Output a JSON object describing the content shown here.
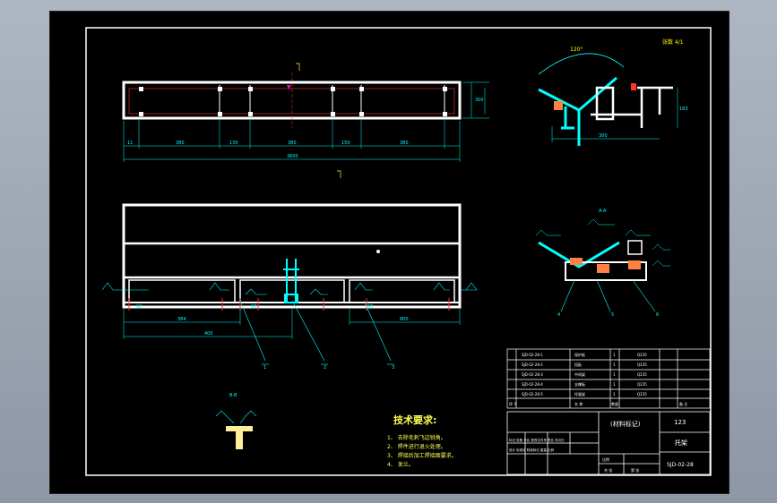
{
  "drawing": {
    "section_aa_label": "A-A",
    "section_bb_label": "B-B",
    "top_view": {
      "overall_length": "3600",
      "spans": [
        "11",
        "380",
        "130",
        "380",
        "150",
        "380"
      ],
      "height_dim": "300"
    },
    "callouts": [
      "1",
      "2",
      "3"
    ],
    "aa_callouts": [
      "4",
      "5",
      "6"
    ],
    "angle_label": "120°",
    "technical_requirements": {
      "title": "技术要求:",
      "items": [
        "1、 去除毛刺飞边锐角。",
        "2、 焊件进行退火处理。",
        "3、 焊接后加工焊接面要求。",
        "4、 发兰。"
      ]
    },
    "title_block": {
      "material_mark": "(材料标记)",
      "part_number_top": "123",
      "part_name": "托架",
      "drawing_number": "SJD-02-28",
      "row_labels": [
        "序 号",
        "名 称",
        "数量",
        "备 注"
      ],
      "scale_label": "比例",
      "bottom_labels": [
        "共 张",
        "第 张"
      ]
    }
  },
  "colors": {
    "frame": "#ffffff",
    "dimension": "#00ffff",
    "center_line": "#ff0000",
    "text": "#ffff00",
    "cut": "#ff8040"
  }
}
